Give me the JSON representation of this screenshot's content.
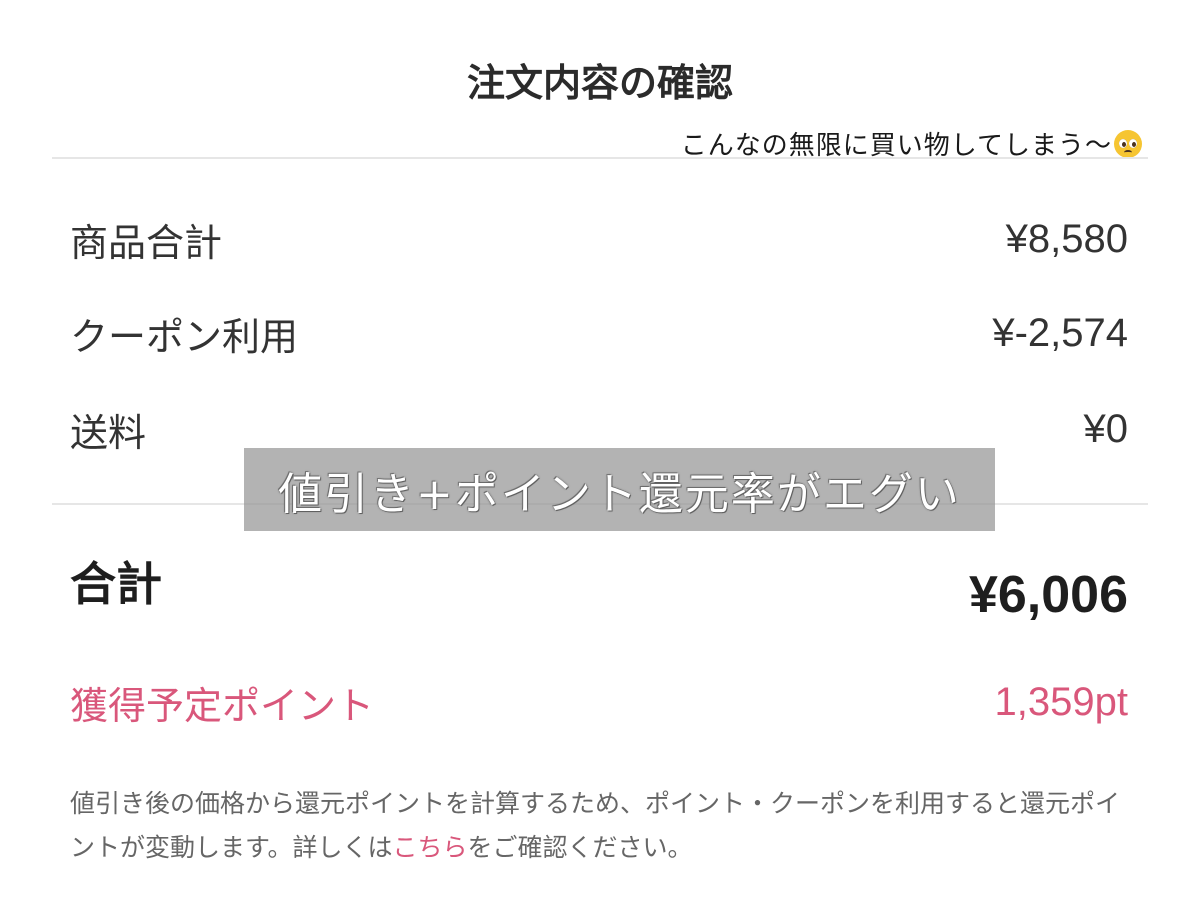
{
  "header": {
    "title": "注文内容の確認"
  },
  "caption": {
    "text": "こんなの無限に買い物してしまう〜",
    "emoji_icon": "pleading-face-emoji"
  },
  "summary": {
    "rows": [
      {
        "label": "商品合計",
        "value": "¥8,580"
      },
      {
        "label": "クーポン利用",
        "value": "¥-2,574"
      },
      {
        "label": "送料",
        "value": "¥0"
      }
    ]
  },
  "total": {
    "label": "合計",
    "value": "¥6,006"
  },
  "points": {
    "label": "獲得予定ポイント",
    "value": "1,359pt"
  },
  "note": {
    "text_before": "値引き後の価格から還元ポイントを計算するため、ポイント・クーポンを利用すると還元ポイントが変動します。詳しくは",
    "link_text": "こちら",
    "text_after": "をご確認ください。"
  },
  "overlay": {
    "text": "値引き+ポイント還元率がエグい"
  },
  "colors": {
    "accent": "#d9577b",
    "divider": "#e6e6e6",
    "overlay_bg": "#969696"
  }
}
